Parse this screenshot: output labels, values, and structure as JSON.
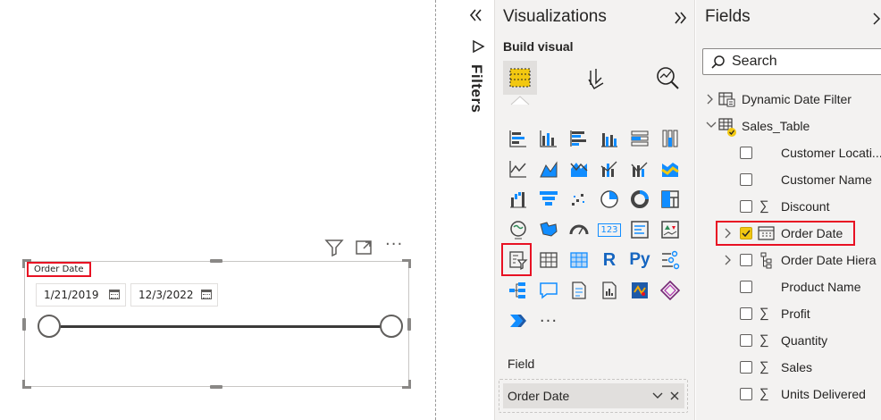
{
  "slicer": {
    "title": "Order Date",
    "start_date": "1/21/2019",
    "end_date": "12/3/2022",
    "range_start": 0,
    "range_end": 1
  },
  "filters_pane": {
    "collapse_icon": "double-chevron-left-icon",
    "label": "Filters"
  },
  "visualizations": {
    "title": "Visualizations",
    "expand_icon": "double-chevron-right-icon",
    "build_visual_label": "Build visual",
    "tabs": [
      "build-visual",
      "format-visual",
      "analytics"
    ],
    "icons": [
      "stacked-bar-chart",
      "stacked-column-chart",
      "clustered-bar-chart",
      "clustered-column-chart",
      "100-stacked-bar-chart",
      "100-stacked-column-chart",
      "line-chart",
      "area-chart",
      "stacked-area-chart",
      "line-clustered-column-chart",
      "line-stacked-column-chart",
      "ribbon-chart",
      "waterfall-chart",
      "funnel-chart",
      "scatter-chart",
      "pie-chart",
      "donut-chart",
      "treemap",
      "map",
      "filled-map",
      "gauge",
      "card",
      "multi-row-card",
      "kpi",
      "slicer",
      "table",
      "matrix",
      "r-visual",
      "python-visual",
      "key-influencers",
      "decomposition-tree",
      "qa",
      "smart-narrative",
      "paginated-report",
      "arcgis-map",
      "power-apps",
      "power-automate",
      "more"
    ],
    "r_label": "R",
    "py_label": "Py",
    "card_label": "123",
    "more_label": "···",
    "field_well_label": "Field",
    "field_chip": "Order Date"
  },
  "fields": {
    "title": "Fields",
    "search_placeholder": "Search",
    "tables": [
      {
        "name": "Dynamic Date Filter",
        "expanded": false
      },
      {
        "name": "Sales_Table",
        "expanded": true
      }
    ],
    "items": [
      {
        "label": "Customer Locati...",
        "checked": false,
        "sigma": false
      },
      {
        "label": "Customer Name",
        "checked": false,
        "sigma": false
      },
      {
        "label": "Discount",
        "checked": false,
        "sigma": true
      },
      {
        "label": "Order Date",
        "checked": true,
        "sigma": false
      },
      {
        "label": "Order Date Hiera",
        "checked": false,
        "sigma": false
      },
      {
        "label": "Product Name",
        "checked": false,
        "sigma": false
      },
      {
        "label": "Profit",
        "checked": false,
        "sigma": true
      },
      {
        "label": "Quantity",
        "checked": false,
        "sigma": true
      },
      {
        "label": "Sales",
        "checked": false,
        "sigma": true
      },
      {
        "label": "Units Delivered",
        "checked": false,
        "sigma": true
      }
    ]
  },
  "colors": {
    "accent_yellow": "#f2c811",
    "highlight_red": "#e81123",
    "pane_bg": "#f3f2f1"
  }
}
